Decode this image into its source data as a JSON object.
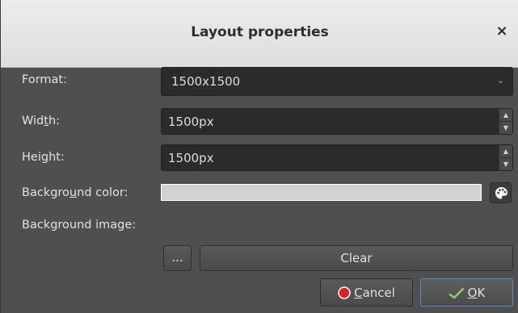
{
  "dialog": {
    "title": "Layout properties",
    "close_glyph": "×"
  },
  "form": {
    "format": {
      "label": "Format:",
      "value": "1500x1500"
    },
    "width": {
      "label_pre": "Wid",
      "label_accel": "t",
      "label_post": "h:",
      "value": "1500px"
    },
    "height": {
      "label_pre": "Hei",
      "label_accel": "g",
      "label_post": "ht:",
      "value": "1500px"
    },
    "background_color": {
      "label_pre": "Backgro",
      "label_accel": "u",
      "label_post": "nd color:",
      "value_hex": "#d2d2d2"
    },
    "background_image": {
      "label": "Background image:"
    }
  },
  "buttons": {
    "browse": "...",
    "clear": "Clear",
    "cancel_accel": "C",
    "cancel_rest": "ancel",
    "ok_accel": "O",
    "ok_rest": "K"
  },
  "icons": {
    "close": "close-icon",
    "dropdown": "chevron-down-icon",
    "spin_up": "spin-up-icon",
    "spin_down": "spin-down-icon",
    "palette": "palette-icon",
    "cancel": "cancel-icon",
    "ok": "ok-icon"
  },
  "colors": {
    "dialog_bg": "#4f4f4f",
    "field_bg": "#2b2b2b",
    "accent": "#5a8cc8",
    "cancel_red": "#e02020",
    "ok_green": "#6aa84f"
  }
}
